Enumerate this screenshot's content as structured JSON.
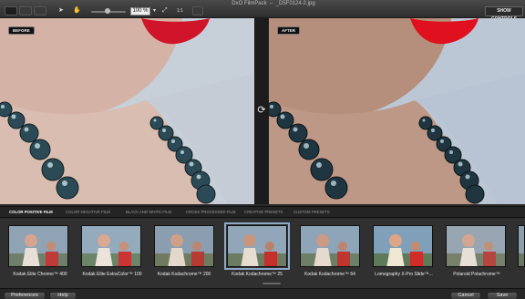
{
  "window": {
    "title": "DxO FilmPack",
    "document": "_D5F0124-2.jpg"
  },
  "toolbar": {
    "zoom_value": "100 %",
    "fit_label": "1:1",
    "show_controls_label": "SHOW CONTROLS"
  },
  "panes": {
    "before_label": "BEFORE",
    "after_label": "AFTER"
  },
  "tabs": [
    {
      "label": "COLOR POSITIVE FILM",
      "active": true
    },
    {
      "label": "COLOR NEGATIVE FILM",
      "active": false
    },
    {
      "label": "BLACK AND WHITE FILM",
      "active": false
    },
    {
      "label": "CROSS PROCESSED FILM",
      "active": false
    },
    {
      "label": "CREATIVE PRESETS",
      "active": false
    },
    {
      "label": "CUSTOM PRESETS",
      "active": false
    }
  ],
  "films": [
    {
      "label": "Kodak Elite Chrome™ 400",
      "selected": false
    },
    {
      "label": "Kodak Elite ExtraColor™ 100",
      "selected": false
    },
    {
      "label": "Kodak Kodachrome™ 200",
      "selected": false
    },
    {
      "label": "Kodak Kodachrome™ 25",
      "selected": true
    },
    {
      "label": "Kodak Kodachrome™ 64",
      "selected": false
    },
    {
      "label": "Lomography X-Pro Slide™...",
      "selected": false
    },
    {
      "label": "Polaroid Polachrome™",
      "selected": false
    }
  ],
  "bottom": {
    "preferences_label": "Preferences",
    "help_label": "Help",
    "cancel_label": "Cancel",
    "save_label": "Save"
  },
  "colors": {
    "accent_selection": "#8ea8c8",
    "lips": "#d0142a",
    "background_dark": "#2a2a2a"
  }
}
